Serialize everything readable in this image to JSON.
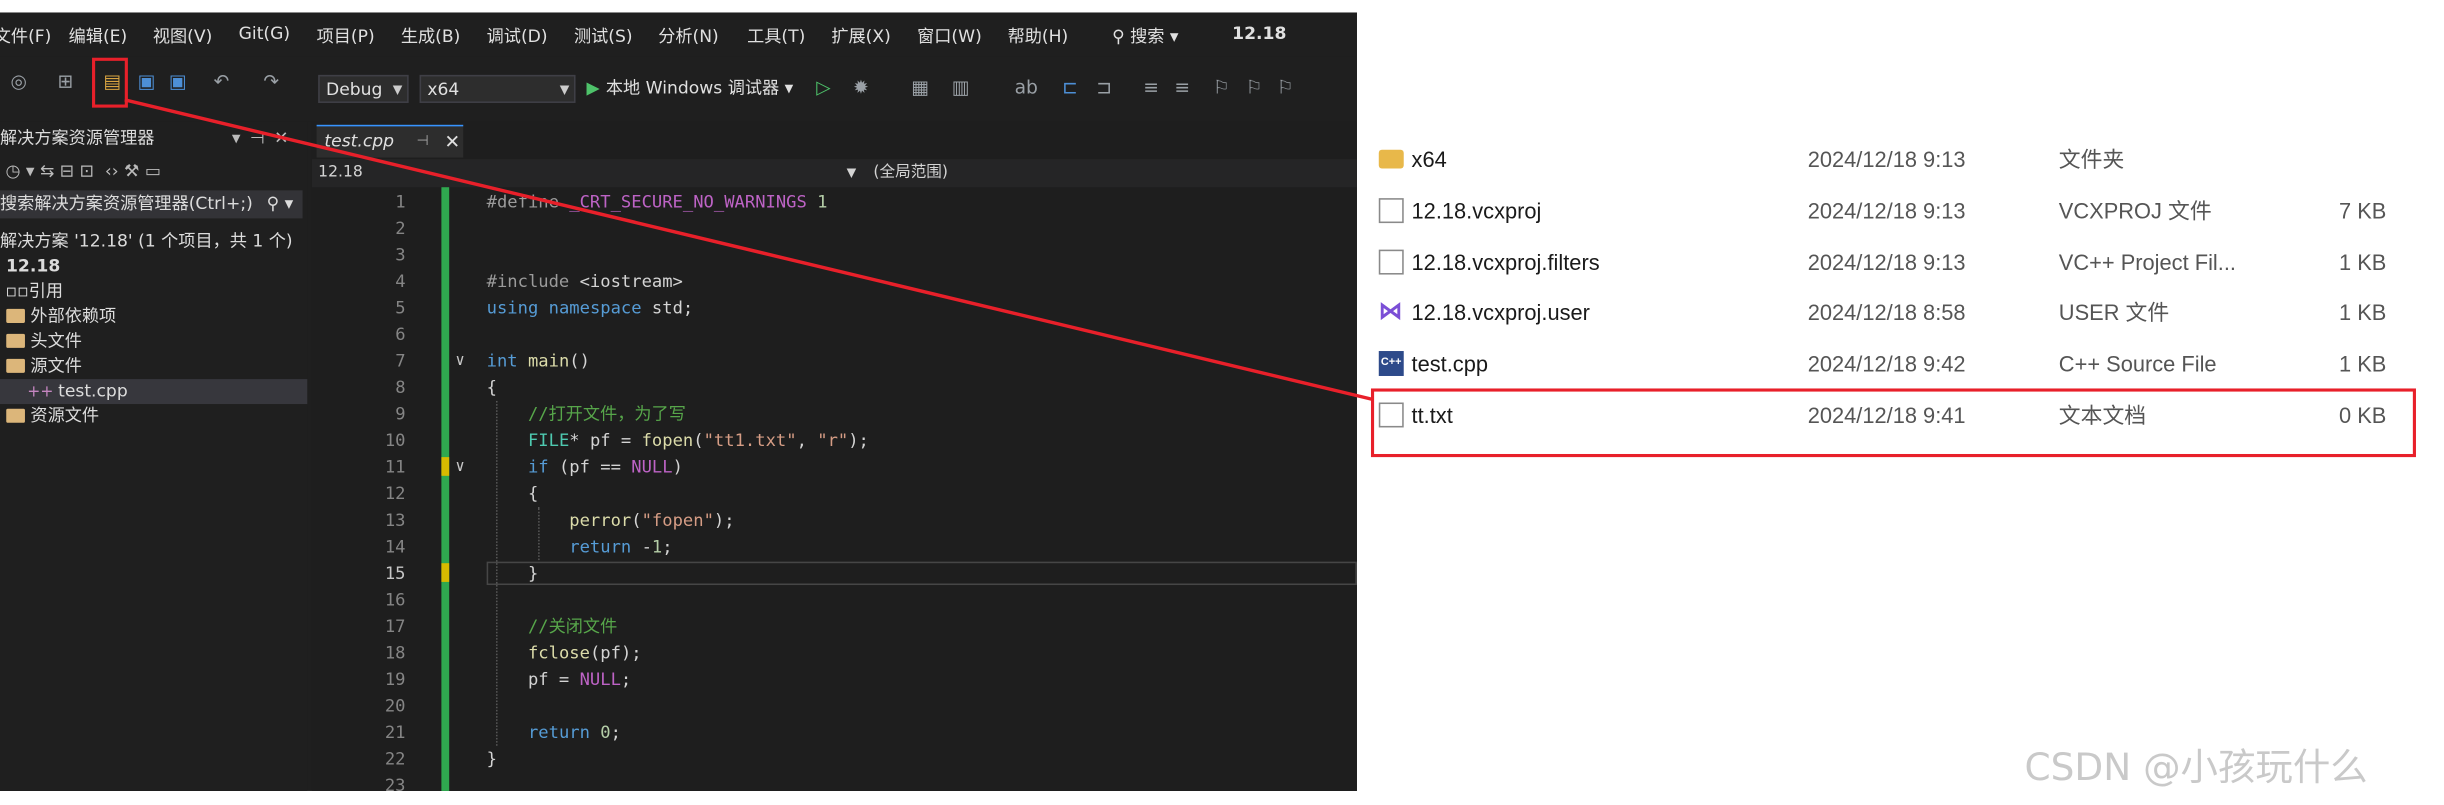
{
  "menubar": {
    "items": [
      "文件(F)",
      "编辑(E)",
      "视图(V)",
      "Git(G)",
      "项目(P)",
      "生成(B)",
      "调试(D)",
      "测试(S)",
      "分析(N)",
      "工具(T)",
      "扩展(X)",
      "窗口(W)",
      "帮助(H)"
    ],
    "search": "搜索",
    "solution_name": "12.18"
  },
  "toolbar": {
    "config": "Debug",
    "platform": "x64",
    "run_label": "本地 Windows 调试器"
  },
  "solution_explorer": {
    "title": "解决方案资源管理器",
    "search_placeholder": "搜索解决方案资源管理器(Ctrl+;)",
    "solution_line": "解决方案 '12.18' (1 个项目，共 1 个)",
    "project": "12.18",
    "nodes": [
      "引用",
      "外部依赖项",
      "头文件",
      "源文件",
      "test.cpp",
      "资源文件"
    ]
  },
  "editor": {
    "tab": "test.cpp",
    "nav_left": "12.18",
    "nav_right": "(全局范围)",
    "current_line": 15
  },
  "code_lines": [
    "#define _CRT_SECURE_NO_WARNINGS 1",
    "",
    "",
    "#include <iostream>",
    "using namespace std;",
    "",
    "int main()",
    "{",
    "    //打开文件，为了写",
    "    FILE* pf = fopen(\"tt1.txt\", \"r\");",
    "    if (pf == NULL)",
    "    {",
    "        perror(\"fopen\");",
    "        return -1;",
    "    }",
    "",
    "    //关闭文件",
    "    fclose(pf);",
    "    pf = NULL;",
    "",
    "    return 0;",
    "}",
    ""
  ],
  "files": [
    {
      "name": "x64",
      "date": "2024/12/18 9:13",
      "type": "文件夹",
      "size": "",
      "icon": "folder-icon"
    },
    {
      "name": "12.18.vcxproj",
      "date": "2024/12/18 9:13",
      "type": "VCXPROJ 文件",
      "size": "7 KB",
      "icon": "document-icon"
    },
    {
      "name": "12.18.vcxproj.filters",
      "date": "2024/12/18 9:13",
      "type": "VC++ Project Fil...",
      "size": "1 KB",
      "icon": "filters-icon"
    },
    {
      "name": "12.18.vcxproj.user",
      "date": "2024/12/18 8:58",
      "type": "USER 文件",
      "size": "1 KB",
      "icon": "visual-studio-icon"
    },
    {
      "name": "test.cpp",
      "date": "2024/12/18 9:42",
      "type": "C++ Source File",
      "size": "1 KB",
      "icon": "cpp-file-icon"
    },
    {
      "name": "tt.txt",
      "date": "2024/12/18 9:41",
      "type": "文本文档",
      "size": "0 KB",
      "icon": "text-file-icon"
    }
  ],
  "annotation_color": "#e8202a",
  "watermark": "CSDN @小孩玩什么"
}
